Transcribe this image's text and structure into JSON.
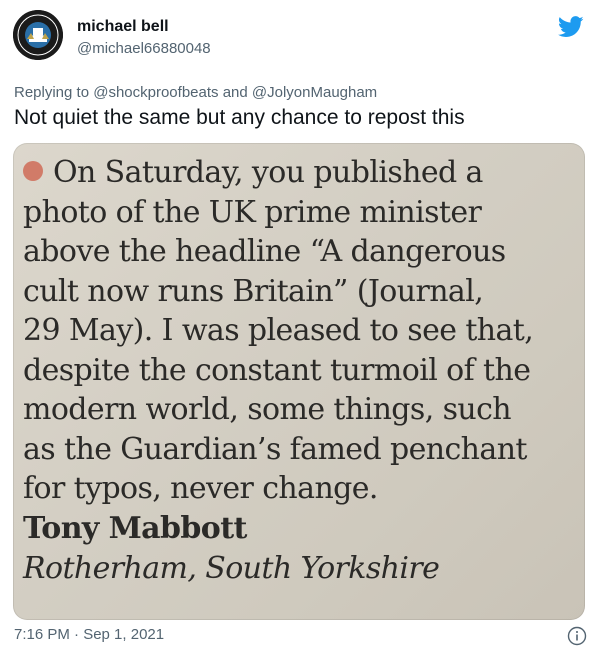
{
  "user": {
    "name": "michael bell",
    "handle": "@michael66880048",
    "avatar_icon": "newcastle-united-crest-icon",
    "avatar_text": "NEWCASTLE UNITED FOOTBALL CLUB"
  },
  "reply": {
    "prefix": "Replying to",
    "mention_1": "@shockproofbeats",
    "joiner": "and",
    "mention_2": "@JolyonMaugham"
  },
  "tweet": {
    "text": "Not quiet the same but any chance to repost this"
  },
  "clipping": {
    "lines": [
      "On Saturday, you published a",
      "photo of the UK prime minister",
      "above the headline “A dangerous",
      "cult now runs Britain” (Journal,",
      "29 May). I was pleased to see that,",
      "despite the constant turmoil of the",
      "modern world, some things, such",
      "as the Guardian’s famed penchant",
      "for typos, never change."
    ],
    "author": "Tony Mabbott",
    "location": "Rotherham, South Yorkshire"
  },
  "meta": {
    "timestamp": "7:16 PM · Sep 1, 2021"
  },
  "icons": {
    "platform": "twitter-bird-icon",
    "info": "info-icon"
  },
  "colors": {
    "twitter_blue": "#1d9bf0",
    "secondary_text": "#536471",
    "bullet": "#d17b68"
  }
}
